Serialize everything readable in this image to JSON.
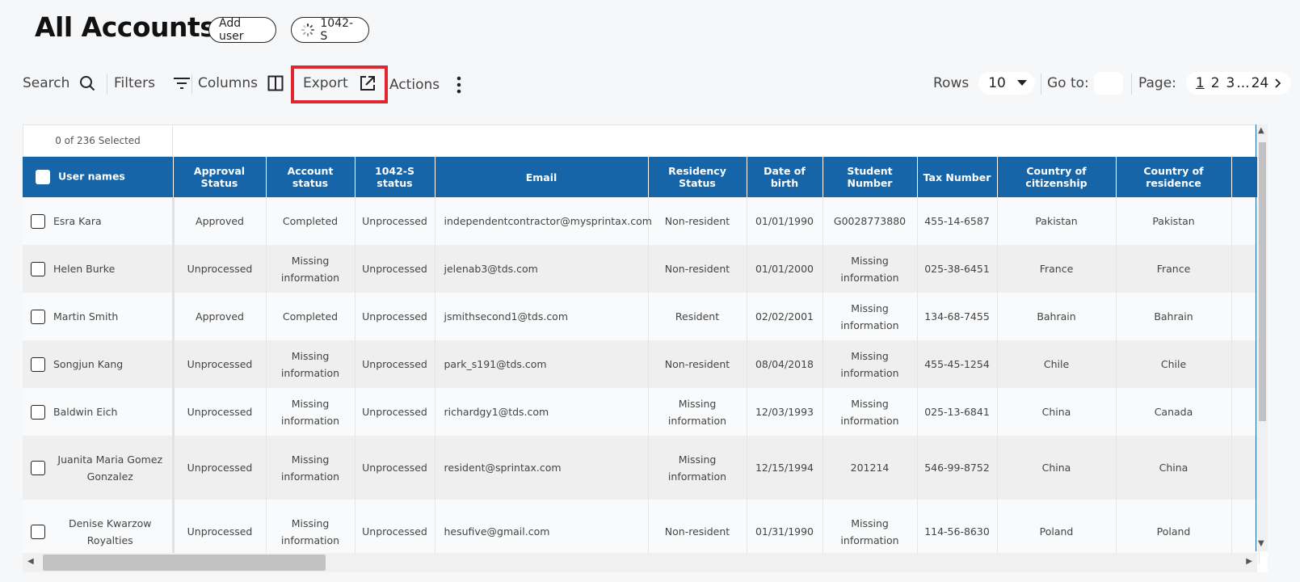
{
  "header": {
    "title": "All Accounts",
    "add_user_label": "Add user",
    "form_label": "1042-S"
  },
  "toolbar": {
    "search_label": "Search",
    "filters_label": "Filters",
    "columns_label": "Columns",
    "export_label": "Export",
    "actions_label": "Actions",
    "rows_label": "Rows",
    "rows_value": "10",
    "goto_label": "Go to:",
    "page_label": "Page:",
    "pages": [
      "1",
      "2",
      "3",
      "...",
      "24"
    ],
    "current_page": "1",
    "highlight_color": "#e0262e"
  },
  "table": {
    "selection_text": "0 of 236 Selected",
    "header_color": "#1565a8",
    "columns": [
      "User names",
      "Approval Status",
      "Account status",
      "1042-S status",
      "Email",
      "Residency Status",
      "Date of birth",
      "Student Number",
      "Tax Number",
      "Country of citizenship",
      "Country of residence"
    ],
    "rows": [
      [
        "Esra Kara",
        "Approved",
        "Completed",
        "Unprocessed",
        "independentcontractor@mysprintax.com",
        "Non-resident",
        "01/01/1990",
        "G0028773880",
        "455-14-6587",
        "Pakistan",
        "Pakistan"
      ],
      [
        "Helen Burke",
        "Unprocessed",
        "Missing information",
        "Unprocessed",
        "jelenab3@tds.com",
        "Non-resident",
        "01/01/2000",
        "Missing information",
        "025-38-6451",
        "France",
        "France"
      ],
      [
        "Martin Smith",
        "Approved",
        "Completed",
        "Unprocessed",
        "jsmithsecond1@tds.com",
        "Resident",
        "02/02/2001",
        "Missing information",
        "134-68-7455",
        "Bahrain",
        "Bahrain"
      ],
      [
        "Songjun Kang",
        "Unprocessed",
        "Missing information",
        "Unprocessed",
        "park_s191@tds.com",
        "Non-resident",
        "08/04/2018",
        "Missing information",
        "455-45-1254",
        "Chile",
        "Chile"
      ],
      [
        "Baldwin Eich",
        "Unprocessed",
        "Missing information",
        "Unprocessed",
        "richardgy1@tds.com",
        "Missing information",
        "12/03/1993",
        "Missing information",
        "025-13-6841",
        "China",
        "Canada"
      ],
      [
        "Juanita Maria Gomez Gonzalez",
        "Unprocessed",
        "Missing information",
        "Unprocessed",
        "resident@sprintax.com",
        "Missing information",
        "12/15/1994",
        "201214",
        "546-99-8752",
        "China",
        "China"
      ],
      [
        "Denise Kwarzow Royalties",
        "Unprocessed",
        "Missing information",
        "Unprocessed",
        "hesufive@gmail.com",
        "Non-resident",
        "01/31/1990",
        "Missing information",
        "114-56-8630",
        "Poland",
        "Poland"
      ]
    ]
  }
}
